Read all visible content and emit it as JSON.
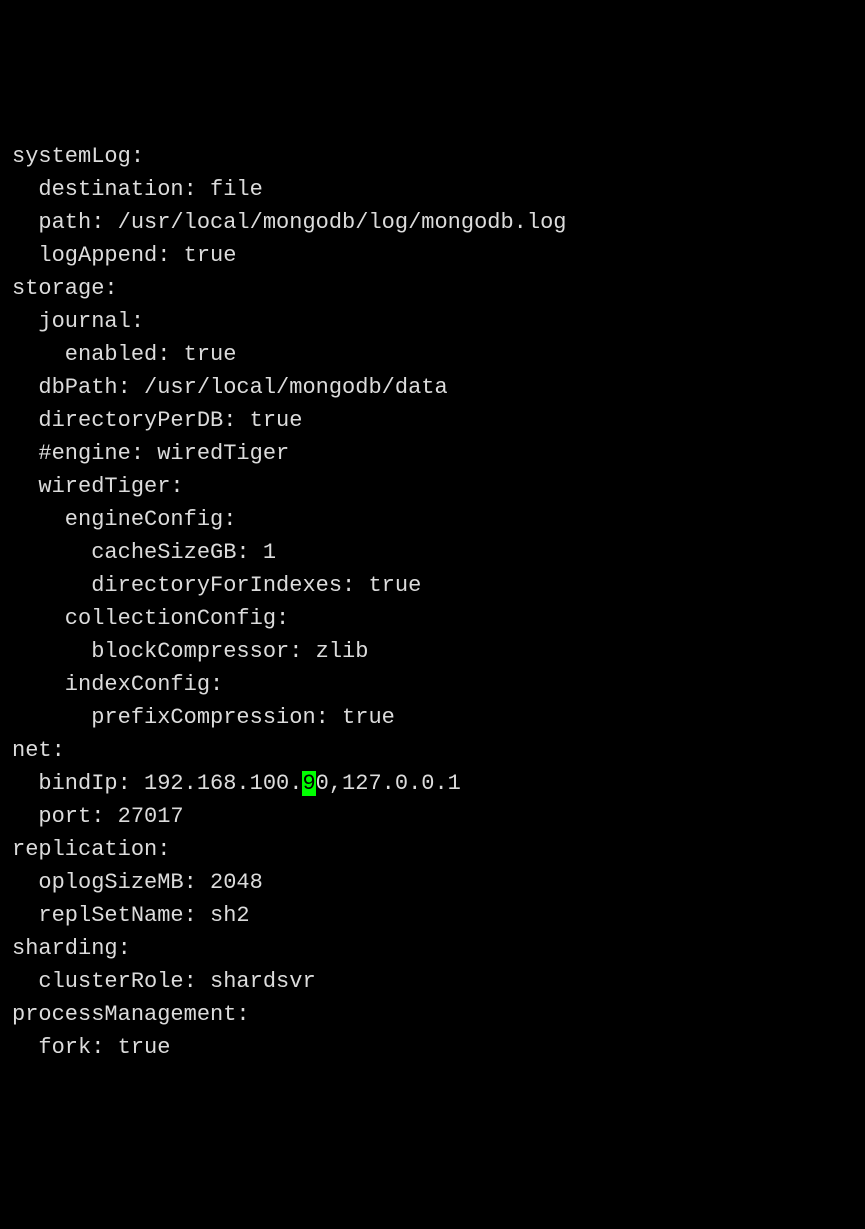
{
  "config": {
    "l01": "systemLog:",
    "l02": "  destination: file",
    "l03": "  path: /usr/local/mongodb/log/mongodb.log",
    "l04": "  logAppend: true",
    "l05": "storage:",
    "l06": "  journal:",
    "l07": "    enabled: true",
    "l08": "  dbPath: /usr/local/mongodb/data",
    "l09": "  directoryPerDB: true",
    "l10": "  #engine: wiredTiger",
    "l11": "  wiredTiger:",
    "l12": "    engineConfig:",
    "l13": "      cacheSizeGB: 1",
    "l14": "      directoryForIndexes: true",
    "l15": "    collectionConfig:",
    "l16": "      blockCompressor: zlib",
    "l17": "    indexConfig:",
    "l18": "      prefixCompression: true",
    "l19": "net:",
    "l20a": "  bindIp: 192.168.100.",
    "l20cursor": "9",
    "l20b": "0,127.0.0.1",
    "l21": "  port: 27017",
    "l22": "replication:",
    "l23": "  oplogSizeMB: 2048",
    "l24": "  replSetName: sh2",
    "l25": "sharding:",
    "l26": "  clusterRole: shardsvr",
    "l27": "processManagement:",
    "l28": "  fork: true"
  }
}
